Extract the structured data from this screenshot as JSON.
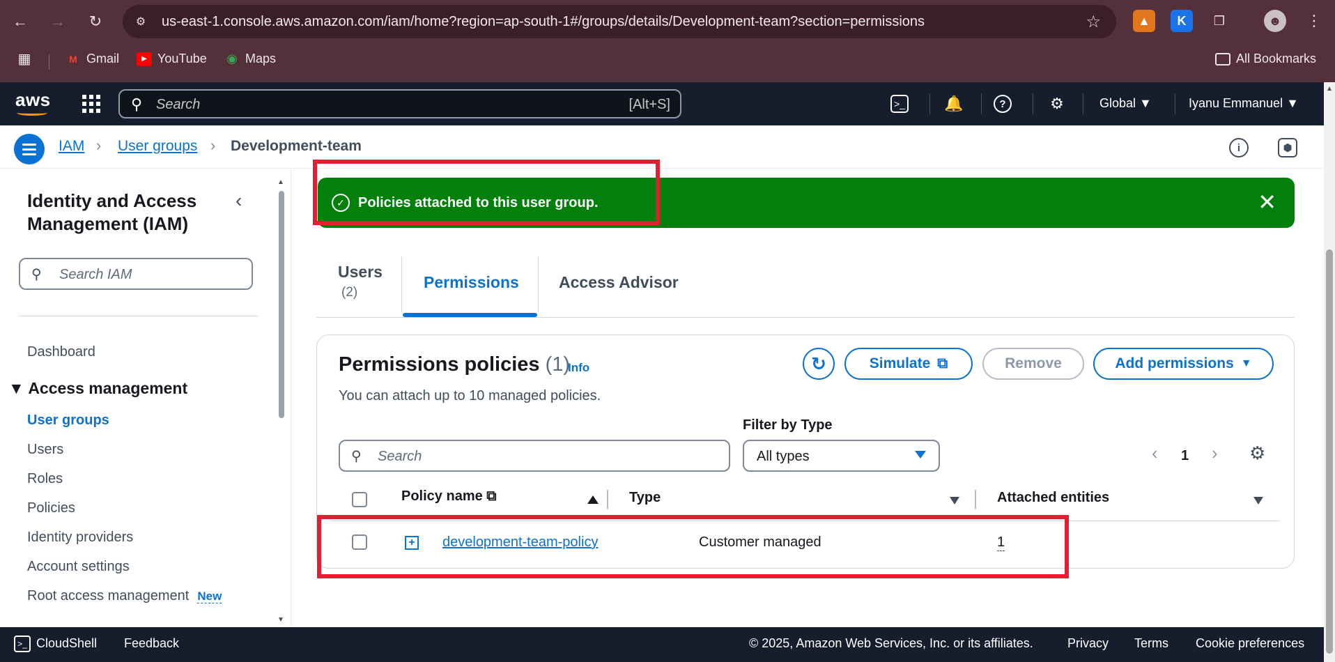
{
  "browser": {
    "url": "us-east-1.console.aws.amazon.com/iam/home?region=ap-south-1#/groups/details/Development-team?section=permissions",
    "bookmarks": [
      {
        "label": "Gmail",
        "icon": "gmail-icon",
        "color": "#ea4335"
      },
      {
        "label": "YouTube",
        "icon": "youtube-icon",
        "color": "#ff0000"
      },
      {
        "label": "Maps",
        "icon": "maps-icon",
        "color": "#34a853"
      }
    ],
    "all_bookmarks": "All Bookmarks"
  },
  "aws_nav": {
    "logo": "aws",
    "search_placeholder": "Search",
    "search_shortcut": "[Alt+S]",
    "region": "Global",
    "user": "Iyanu Emmanuel"
  },
  "breadcrumb": [
    "IAM",
    "User groups",
    "Development-team"
  ],
  "sidebar": {
    "title": "Identity and Access Management (IAM)",
    "search_placeholder": "Search IAM",
    "dashboard": "Dashboard",
    "section": "Access management",
    "items": [
      "User groups",
      "Users",
      "Roles",
      "Policies",
      "Identity providers",
      "Account settings",
      "Root access management"
    ],
    "active_item": "User groups",
    "new_badge": "New"
  },
  "flash": {
    "message": "Policies attached to this user group.",
    "color": "#037f0c"
  },
  "tabs": [
    {
      "label": "Users",
      "count": "(2)"
    },
    {
      "label": "Permissions",
      "count": ""
    },
    {
      "label": "Access Advisor",
      "count": ""
    }
  ],
  "policies": {
    "title": "Permissions policies",
    "count": "(1)",
    "info": "Info",
    "description": "You can attach up to 10 managed policies.",
    "buttons": {
      "simulate": "Simulate",
      "remove": "Remove",
      "add": "Add permissions"
    },
    "filter_label": "Filter by Type",
    "search_placeholder": "Search",
    "filter_value": "All types",
    "page": "1",
    "columns": [
      "Policy name",
      "Type",
      "Attached entities"
    ],
    "rows": [
      {
        "name": "development-team-policy",
        "type": "Customer managed",
        "attached": "1"
      }
    ]
  },
  "footer": {
    "cloudshell": "CloudShell",
    "feedback": "Feedback",
    "copyright": "© 2025, Amazon Web Services, Inc. or its affiliates.",
    "privacy": "Privacy",
    "terms": "Terms",
    "cookies": "Cookie preferences"
  },
  "colors": {
    "accent": "#0972d3",
    "highlight": "#e02030",
    "nav_bg": "#161e2d",
    "browser_bg": "#54303a"
  }
}
